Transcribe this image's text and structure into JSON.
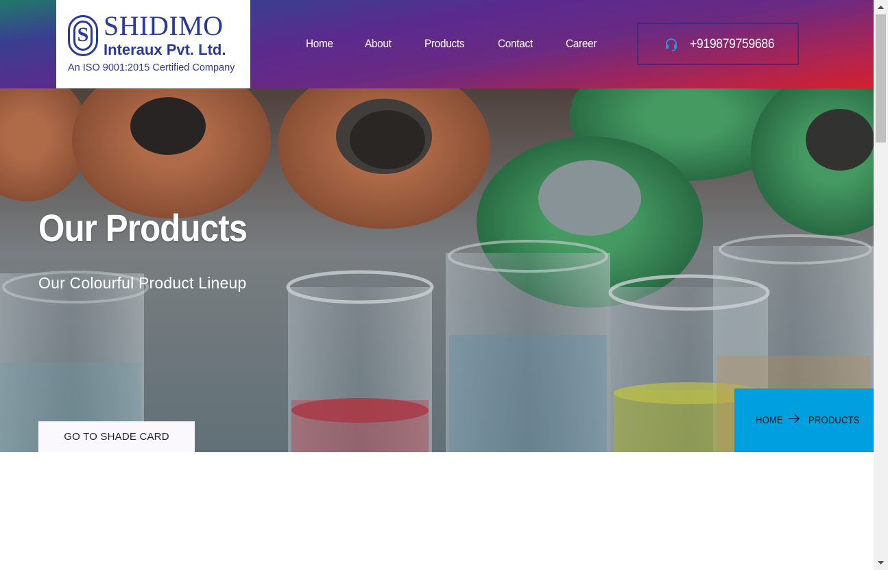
{
  "brand": {
    "mark_letter": "S",
    "name": "SHIDIMO",
    "subname": "Interaux Pvt. Ltd.",
    "certification": "An ISO 9001:2015 Certified Company",
    "brand_color": "#2a3a9c"
  },
  "nav": {
    "items": [
      {
        "label": "Home"
      },
      {
        "label": "About"
      },
      {
        "label": "Products"
      },
      {
        "label": "Contact"
      },
      {
        "label": "Career"
      }
    ]
  },
  "contact": {
    "icon": "headset-icon",
    "phone": "+919879759686",
    "icon_color": "#1e9be0"
  },
  "hero": {
    "title": "Our Products",
    "subtitle": "Our Colourful Product Lineup",
    "cta_label": "GO TO SHADE CARD"
  },
  "breadcrumb": {
    "home": "HOME",
    "separator_icon": "arrow-right-icon",
    "current": "PRODUCTS",
    "background": "#00a0e0"
  },
  "colors": {
    "header_gradient": [
      "#1f7a6a",
      "#5b2a8e",
      "#d4202e"
    ]
  }
}
